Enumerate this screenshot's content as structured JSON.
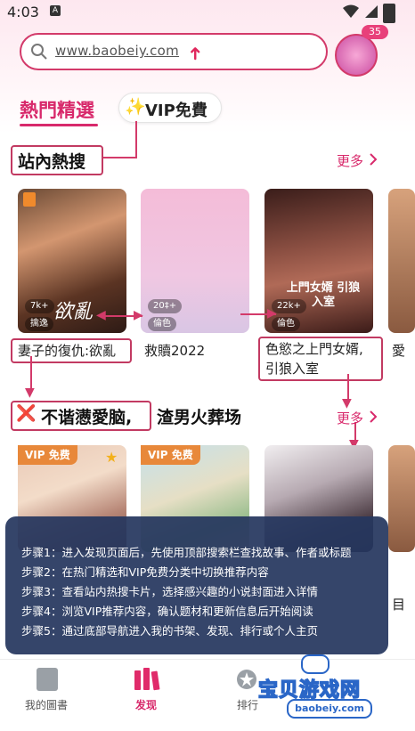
{
  "status_bar": {
    "time": "4:03",
    "notification_glyph": "A",
    "battery_level": 1.0
  },
  "search": {
    "url_text": "www.baobeiy.com",
    "arrow_glyph": "➜"
  },
  "avatar": {
    "badge_count": "35"
  },
  "tabs": [
    {
      "label": "熱門精選",
      "active": true
    },
    {
      "label": "VIP免費",
      "active": false,
      "star_glyph": "✨"
    }
  ],
  "hot_section": {
    "title": "站內熱搜",
    "more_label": "更多",
    "books": [
      {
        "title": "妻子的復仇:欲亂",
        "views": "7k+",
        "tag": "擒逸",
        "cover_text": "欲亂"
      },
      {
        "title": "救贖2022",
        "views": "20‡+",
        "tag": "倫色",
        "cover_text": ""
      },
      {
        "title_line1": "色慾之上門女婿,",
        "title_line2": "引狼入室",
        "views": "22k+",
        "tag": "倫色",
        "cover_text": "上門女婿 引狼入室"
      },
      {
        "title": "愛",
        "partial": true
      }
    ]
  },
  "vip_section": {
    "title_icon": "❌",
    "title_main": "不谐懑愛脑,",
    "title_rest": "渣男火葬场",
    "more_label": "更多",
    "badges": [
      "VIP 免费",
      "VIP 免费"
    ],
    "side_text": "目"
  },
  "steps": [
    "步骤1：进入发现页面后，先使用顶部搜索栏查找故事、作者或标题",
    "步骤2：在热门精选和VIP免费分类中切换推荐内容",
    "步骤3：查看站内热搜卡片，选择感兴趣的小说封面进入详情",
    "步骤4：浏览VIP推荐内容，确认题材和更新信息后开始阅读",
    "步骤5：通过底部导航进入我的书架、发现、排行或个人主页"
  ],
  "bottom_nav": [
    {
      "label": "我的圖書",
      "active": false
    },
    {
      "label": "发现",
      "active": true
    },
    {
      "label": "排行",
      "active": false
    },
    {
      "label": "页",
      "active": false
    }
  ],
  "watermark": {
    "brand": "宝贝游戏网",
    "url": "baobeiy.com"
  },
  "colors": {
    "accent": "#d8296b",
    "annotation_red": "#d33a6a",
    "overlay": "#26375f",
    "vip_orange": "#e8883a"
  }
}
